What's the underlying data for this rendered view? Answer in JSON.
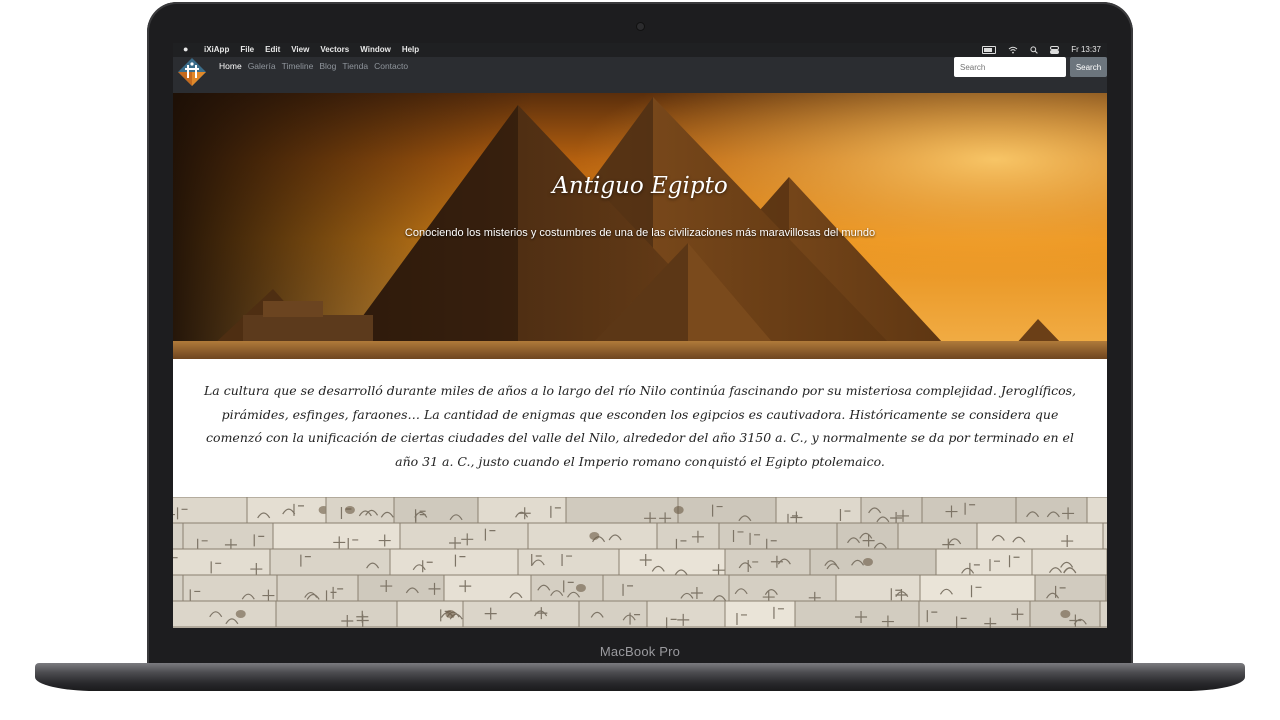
{
  "device": {
    "label": "MacBook Pro"
  },
  "menubar": {
    "app_name": "iXiApp",
    "menus": [
      "File",
      "Edit",
      "View",
      "Vectors",
      "Window",
      "Help"
    ],
    "clock": "Fr 13:37"
  },
  "navbar": {
    "links": [
      {
        "label": "Home",
        "active": true
      },
      {
        "label": "Galería",
        "active": false
      },
      {
        "label": "Timeline",
        "active": false
      },
      {
        "label": "Blog",
        "active": false
      },
      {
        "label": "Tienda",
        "active": false
      },
      {
        "label": "Contacto",
        "active": false
      }
    ],
    "search_placeholder": "Search",
    "search_button": "Search"
  },
  "hero": {
    "title": "Antiguo Egipto",
    "subtitle": "Conociendo los misterios y costumbres de una de las civilizaciones más maravillosas del mundo"
  },
  "intro": {
    "text": "La cultura que se desarrolló durante miles de años a lo largo del río Nilo continúa fascinando por su misteriosa complejidad. Jeroglíficos, pirámides, esfinges, faraones… La cantidad de enigmas que esconden los egipcios es cautivadora. Históricamente se considera que comenzó con la unificación de ciertas ciudades del valle del Nilo, alrededor del año 3150 a. C., y normalmente se da por terminado en el año 31 a. C., justo cuando el Imperio romano conquistó el Egipto ptolemaico."
  },
  "colors": {
    "navbar_bg": "#2b2d31",
    "sky_orange": "#e8901a",
    "pyramid_brown": "#6b3f17",
    "stone": "#d6d1c6"
  }
}
